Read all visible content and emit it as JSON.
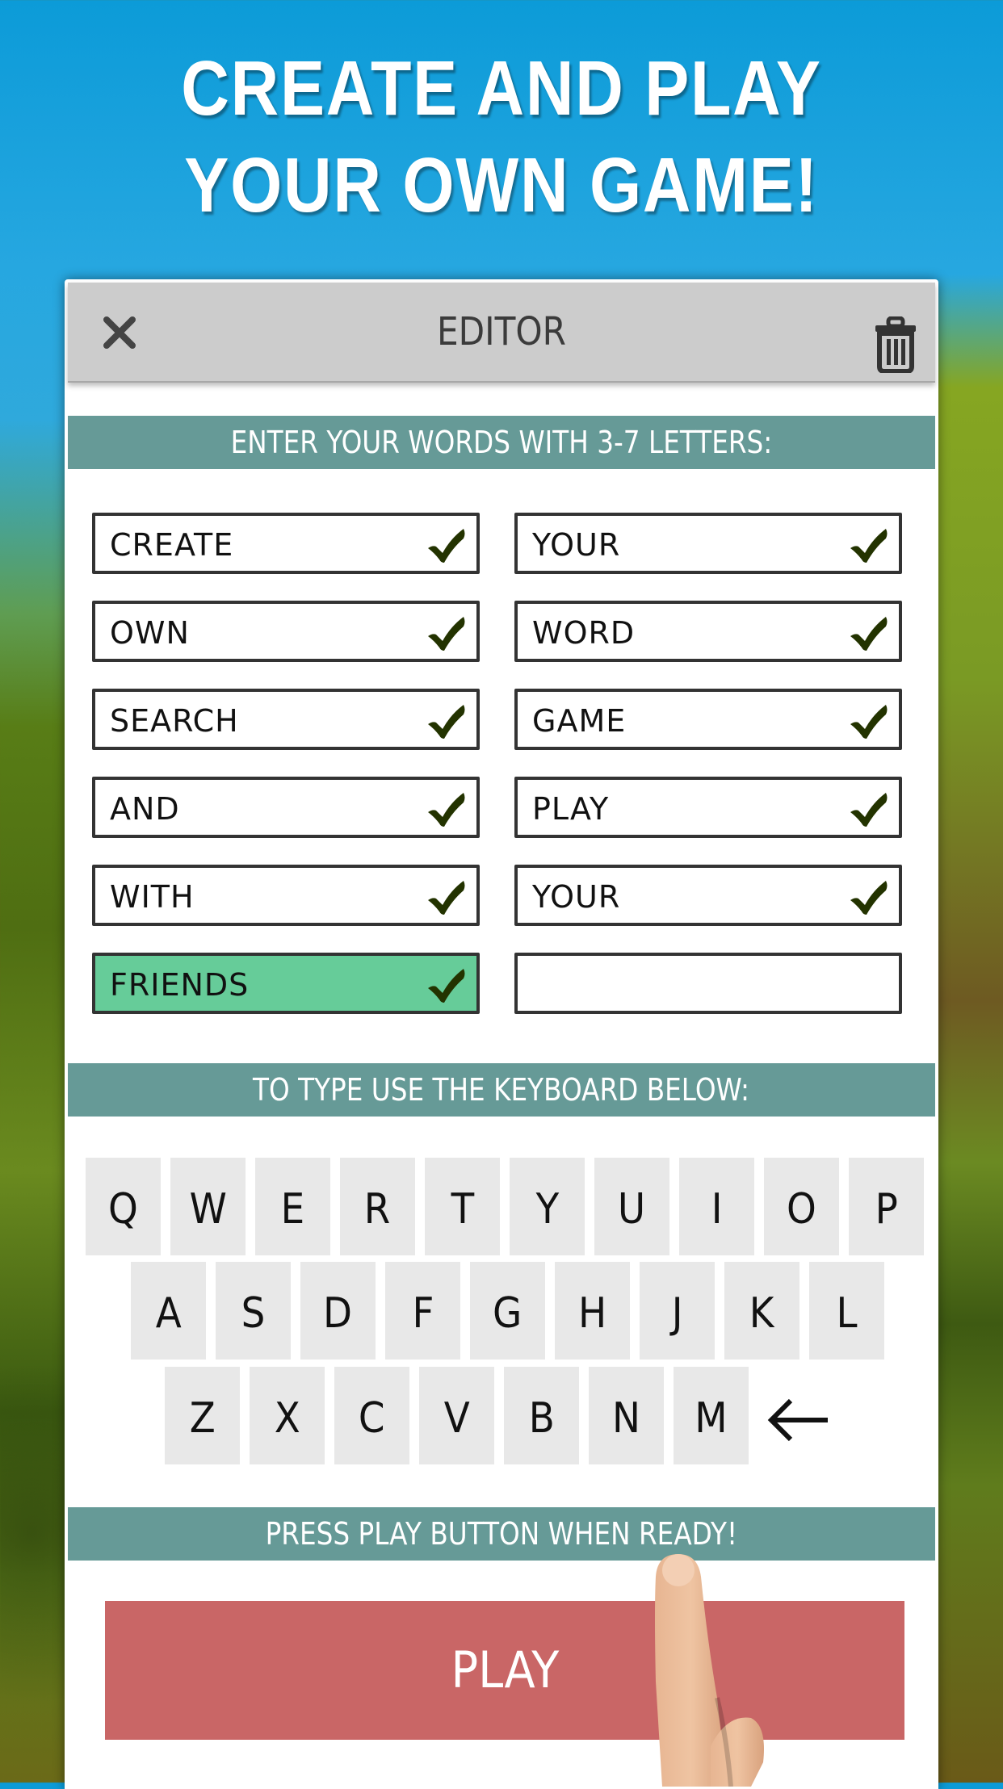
{
  "promo": {
    "headline_line1": "CREATE AND PLAY",
    "headline_line2": "YOUR OWN GAME!"
  },
  "editor": {
    "title": "EDITOR",
    "close_icon": "close-x-icon",
    "trash_icon": "trash-icon",
    "instruction_words": "ENTER YOUR WORDS WITH 3-7 LETTERS:",
    "instruction_keyboard": "TO TYPE USE THE KEYBOARD BELOW:",
    "instruction_play": "PRESS PLAY BUTTON WHEN READY!",
    "word_fields": [
      {
        "value": "CREATE",
        "valid": true,
        "active": false
      },
      {
        "value": "YOUR",
        "valid": true,
        "active": false
      },
      {
        "value": "OWN",
        "valid": true,
        "active": false
      },
      {
        "value": "WORD",
        "valid": true,
        "active": false
      },
      {
        "value": "SEARCH",
        "valid": true,
        "active": false
      },
      {
        "value": "GAME",
        "valid": true,
        "active": false
      },
      {
        "value": "AND",
        "valid": true,
        "active": false
      },
      {
        "value": "PLAY",
        "valid": true,
        "active": false
      },
      {
        "value": "WITH",
        "valid": true,
        "active": false
      },
      {
        "value": "YOUR",
        "valid": true,
        "active": false
      },
      {
        "value": "FRIENDS",
        "valid": true,
        "active": true
      },
      {
        "value": "",
        "valid": false,
        "active": false
      }
    ],
    "keyboard": {
      "row1": [
        "Q",
        "W",
        "E",
        "R",
        "T",
        "Y",
        "U",
        "I",
        "O",
        "P"
      ],
      "row2": [
        "A",
        "S",
        "D",
        "F",
        "G",
        "H",
        "J",
        "K",
        "L"
      ],
      "row3": [
        "Z",
        "X",
        "C",
        "V",
        "B",
        "N",
        "M"
      ],
      "backspace_icon": "left-arrow-icon"
    },
    "play_label": "PLAY"
  },
  "colors": {
    "banner": "#669a97",
    "header": "#cccccc",
    "active_field": "#66cc99",
    "check": "#233300",
    "play": "#c96666",
    "key": "#e8e8e8"
  }
}
